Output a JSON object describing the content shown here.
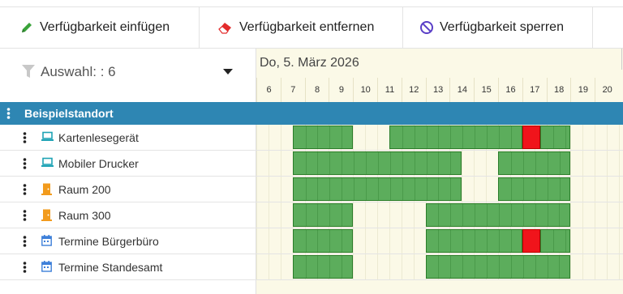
{
  "toolbar": {
    "insert_label": "Verfügbarkeit einfügen",
    "remove_label": "Verfügbarkeit entfernen",
    "block_label": "Verfügbarkeit sperren"
  },
  "filter": {
    "label": "Auswahl: : 6"
  },
  "timeline": {
    "date": "Do, 5. März 2026",
    "hours": [
      "6",
      "7",
      "8",
      "9",
      "10",
      "11",
      "12",
      "13",
      "14",
      "15",
      "16",
      "17",
      "18",
      "19",
      "20"
    ]
  },
  "group": {
    "title": "Beispielstandort"
  },
  "colors": {
    "available": "#5cad5c",
    "blocked": "#f0141b",
    "group_header": "#2e86b3"
  },
  "resources": [
    {
      "name": "Kartenlesegerät",
      "icon": "laptop-icon",
      "available": [
        [
          7.5,
          10
        ],
        [
          11.5,
          17
        ]
      ],
      "blocked": [
        [
          17,
          17.75
        ]
      ],
      "available_after": [
        [
          17.75,
          19
        ]
      ]
    },
    {
      "name": "Mobiler Drucker",
      "icon": "laptop-icon",
      "available": [
        [
          7.5,
          14.5
        ],
        [
          16,
          19
        ]
      ],
      "blocked": [],
      "available_after": []
    },
    {
      "name": "Raum 200",
      "icon": "door-icon",
      "available": [
        [
          7.5,
          14.5
        ],
        [
          16,
          19
        ]
      ],
      "blocked": [],
      "available_after": []
    },
    {
      "name": "Raum 300",
      "icon": "door-icon",
      "available": [
        [
          7.5,
          10
        ],
        [
          13,
          19
        ]
      ],
      "blocked": [],
      "available_after": []
    },
    {
      "name": "Termine Bürgerbüro",
      "icon": "calendar-icon",
      "available": [
        [
          7.5,
          10
        ],
        [
          13,
          17
        ]
      ],
      "blocked": [
        [
          17,
          17.75
        ]
      ],
      "available_after": [
        [
          17.75,
          19
        ]
      ]
    },
    {
      "name": "Termine Standesamt",
      "icon": "calendar-icon",
      "available": [
        [
          7.5,
          10
        ],
        [
          13,
          19
        ]
      ],
      "blocked": [],
      "available_after": []
    }
  ]
}
